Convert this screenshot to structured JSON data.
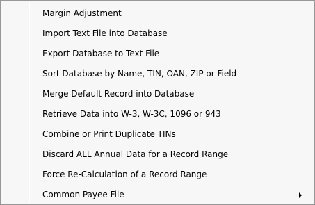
{
  "menu": {
    "items": [
      {
        "label": "Margin Adjustment"
      },
      {
        "label": "Import Text File into Database"
      },
      {
        "label": "Export Database to Text File"
      },
      {
        "label": "Sort Database by Name, TIN, OAN, ZIP or Field"
      },
      {
        "label": "Merge Default Record into Database"
      },
      {
        "label": "Retrieve Data into W-3, W-3C, 1096 or 943"
      },
      {
        "label": "Combine or Print Duplicate TINs"
      },
      {
        "label": "Discard ALL Annual Data for a Record Range"
      },
      {
        "label": "Force Re-Calculation of a Record Range"
      },
      {
        "label": "Common Payee File",
        "submenu_icon": "chevron-right-icon"
      }
    ]
  }
}
